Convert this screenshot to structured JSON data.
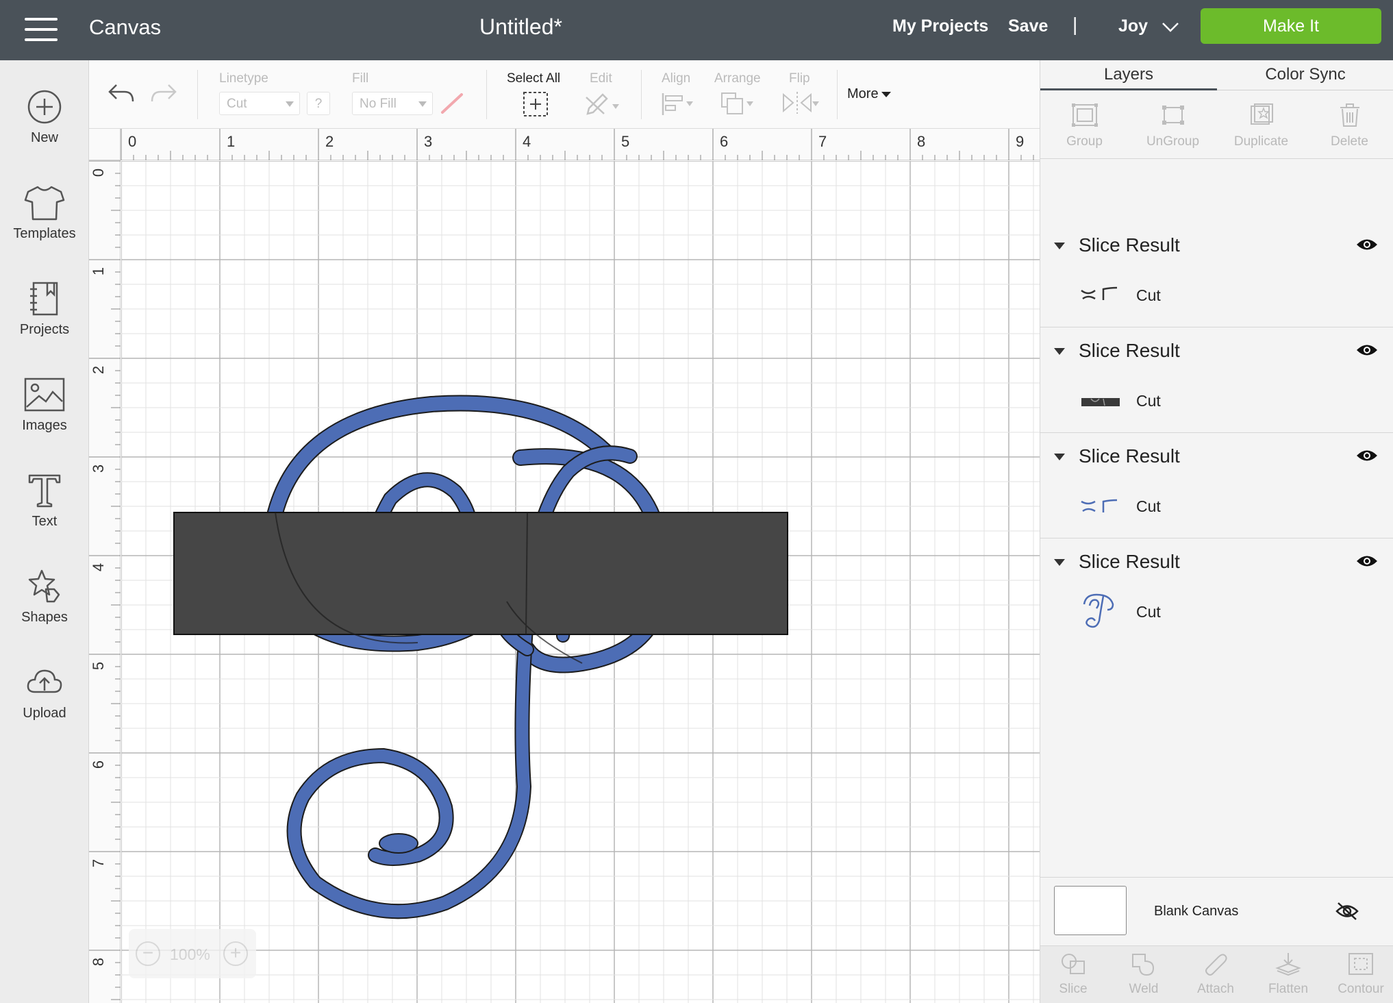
{
  "header": {
    "app_name": "Canvas",
    "doc_title": "Untitled*",
    "my_projects": "My Projects",
    "save": "Save",
    "separator": "|",
    "user": "Joy",
    "make_it": "Make It",
    "bg_color": "#4a5259",
    "make_it_color": "#6cbb2b"
  },
  "sidebar": {
    "items": [
      {
        "label": "New",
        "icon": "plus-circle-icon"
      },
      {
        "label": "Templates",
        "icon": "tshirt-icon"
      },
      {
        "label": "Projects",
        "icon": "notebook-icon"
      },
      {
        "label": "Images",
        "icon": "image-icon"
      },
      {
        "label": "Text",
        "icon": "text-t-icon"
      },
      {
        "label": "Shapes",
        "icon": "shapes-icon"
      },
      {
        "label": "Upload",
        "icon": "cloud-upload-icon"
      }
    ]
  },
  "toolbar": {
    "linetype_label": "Linetype",
    "linetype_value": "Cut",
    "help": "?",
    "fill_label": "Fill",
    "fill_value": "No Fill",
    "select_all_label": "Select All",
    "edit_label": "Edit",
    "align_label": "Align",
    "arrange_label": "Arrange",
    "flip_label": "Flip",
    "more_label": "More"
  },
  "canvas": {
    "ruler_h": [
      "0",
      "1",
      "2",
      "3",
      "4",
      "5",
      "6",
      "7",
      "8",
      "9"
    ],
    "ruler_v": [
      "0",
      "1",
      "2",
      "3",
      "4",
      "5",
      "6",
      "7",
      "8"
    ],
    "zoom": "100%",
    "zoom_minus": "−",
    "zoom_plus": "+",
    "letter_color": "#4d6db5",
    "rect_color": "#464646"
  },
  "rightpanel": {
    "tabs": [
      {
        "label": "Layers",
        "active": true
      },
      {
        "label": "Color Sync",
        "active": false
      }
    ],
    "layer_tools": [
      {
        "label": "Group",
        "icon": "group-icon"
      },
      {
        "label": "UnGroup",
        "icon": "ungroup-icon"
      },
      {
        "label": "Duplicate",
        "icon": "duplicate-icon"
      },
      {
        "label": "Delete",
        "icon": "trash-icon"
      }
    ],
    "layers": [
      {
        "title": "Slice Result",
        "linetype": "Cut",
        "thumb": "dark-fragments"
      },
      {
        "title": "Slice Result",
        "linetype": "Cut",
        "thumb": "dark-bar"
      },
      {
        "title": "Slice Result",
        "linetype": "Cut",
        "thumb": "blue-fragments"
      },
      {
        "title": "Slice Result",
        "linetype": "Cut",
        "thumb": "blue-letter"
      }
    ],
    "blank_canvas_label": "Blank Canvas",
    "bottom_tools": [
      {
        "label": "Slice",
        "icon": "slice-icon"
      },
      {
        "label": "Weld",
        "icon": "weld-icon"
      },
      {
        "label": "Attach",
        "icon": "attach-icon"
      },
      {
        "label": "Flatten",
        "icon": "flatten-icon"
      },
      {
        "label": "Contour",
        "icon": "contour-icon"
      }
    ]
  }
}
